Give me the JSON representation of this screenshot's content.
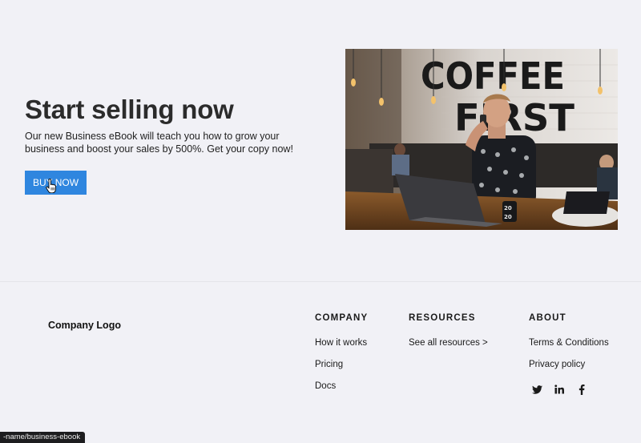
{
  "hero": {
    "title": "Start selling now",
    "description": "Our new Business eBook will teach you how to grow your business and boost your sales by 500%. Get your copy now!",
    "cta_label": "BUY NOW",
    "image_alt": "Man on phone at laptop in coffee shop",
    "image_sign_text": [
      "COFFEE",
      "FIRST"
    ],
    "mug_text": [
      "20",
      "20"
    ]
  },
  "footer": {
    "logo": "Company Logo",
    "columns": [
      {
        "heading": "COMPANY",
        "links": [
          "How it works",
          "Pricing",
          "Docs"
        ]
      },
      {
        "heading": "RESOURCES",
        "links": [
          "See all resources >"
        ]
      },
      {
        "heading": "ABOUT",
        "links": [
          "Terms & Conditions",
          "Privacy policy"
        ]
      }
    ],
    "social": [
      "twitter-icon",
      "linkedin-icon",
      "facebook-icon"
    ]
  },
  "status_url": "-name/business-ebook",
  "colors": {
    "accent": "#2f86df",
    "background": "#f1f1f6",
    "text": "#2b2b2b"
  }
}
